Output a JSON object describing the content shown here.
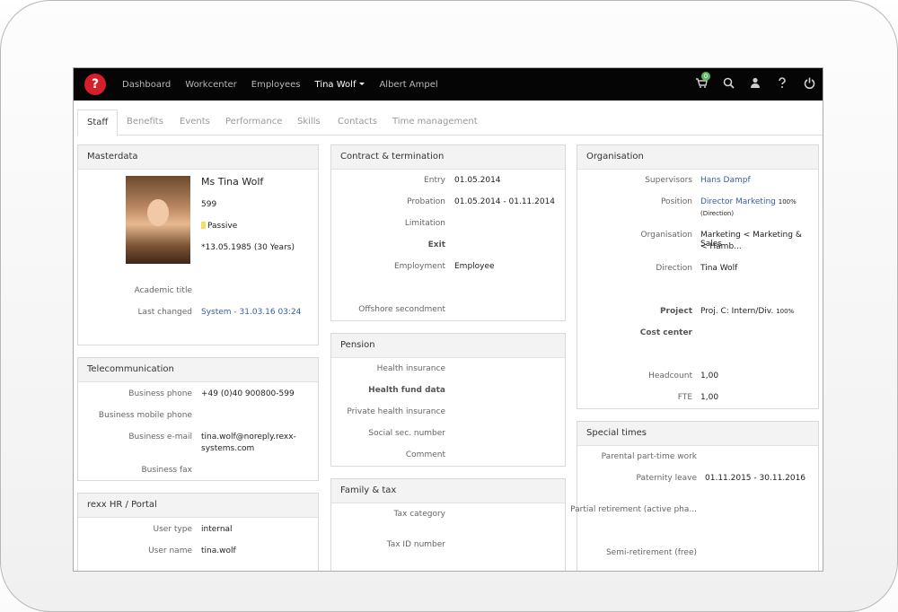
{
  "nav": {
    "items": [
      "Dashboard",
      "Workcenter",
      "Employees"
    ],
    "active": "Tina Wolf",
    "other": "Albert Ampel"
  },
  "topbar": {
    "cart_count": "0",
    "logo_glyph": "?"
  },
  "tabs": [
    "Staff",
    "Benefits",
    "Events",
    "Performance",
    "Skills",
    "Contacts",
    "Time management"
  ],
  "masterdata": {
    "title": "Masterdata",
    "name": "Ms Tina Wolf",
    "id": "599",
    "status": "Passive",
    "birth": "*13.05.1985 (30 Years)",
    "academic_label": "Academic title",
    "changed_label": "Last changed",
    "changed_value": "System - 31.03.16 03:24"
  },
  "telecom": {
    "title": "Telecommunication",
    "business_phone_label": "Business phone",
    "business_phone": "+49 (0)40 900800-599",
    "mobile_label": "Business mobile phone",
    "email_label": "Business e-mail",
    "email_1": "tina.wolf@noreply.rexx-",
    "email_2": "systems.com",
    "fax_label": "Business fax"
  },
  "portal": {
    "title": "rexx HR / Portal",
    "user_type_label": "User type",
    "user_type": "internal",
    "user_name_label": "User name",
    "user_name": "tina.wolf"
  },
  "contract": {
    "title": "Contract & termination",
    "entry_label": "Entry",
    "entry": "01.05.2014",
    "probation_label": "Probation",
    "probation": "01.05.2014 - 01.11.2014",
    "limitation_label": "Limitation",
    "exit_label": "Exit",
    "employment_label": "Employment",
    "employment": "Employee",
    "offshore_label": "Offshore secondment"
  },
  "pension": {
    "title": "Pension",
    "health_label": "Health insurance",
    "fund_label": "Health fund data",
    "private_label": "Private health insurance",
    "social_label": "Social sec. number",
    "comment_label": "Comment"
  },
  "family": {
    "title": "Family & tax",
    "tax_cat_label": "Tax category",
    "tax_id_label": "Tax ID number"
  },
  "org": {
    "title": "Organisation",
    "supervisors_label": "Supervisors",
    "supervisors": "Hans Dampf",
    "position_label": "Position",
    "position": "Director Marketing",
    "position_pct": "100%",
    "position_sub": "(Direction)",
    "org_label": "Organisation",
    "org_1": "Marketing < Marketing & Sales",
    "org_2": "< Hamb...",
    "direction_label": "Direction",
    "direction": "Tina Wolf",
    "project_label": "Project",
    "project": "Proj. C: Intern/Div.",
    "project_pct": "100%",
    "cost_label": "Cost center",
    "headcount_label": "Headcount",
    "headcount": "1,00",
    "fte_label": "FTE",
    "fte": "1,00"
  },
  "special": {
    "title": "Special times",
    "parental_label": "Parental part-time work",
    "paternity_label": "Paternity leave",
    "paternity": "01.11.2015 - 30.11.2016",
    "partial_label": "Partial retirement (active pha...",
    "semi_label": "Semi-retirement (free)"
  },
  "colors": {
    "link": "#3a5da8",
    "status": "#f0e05a",
    "badge": "#5cb85c",
    "logo": "#d61f2a"
  }
}
